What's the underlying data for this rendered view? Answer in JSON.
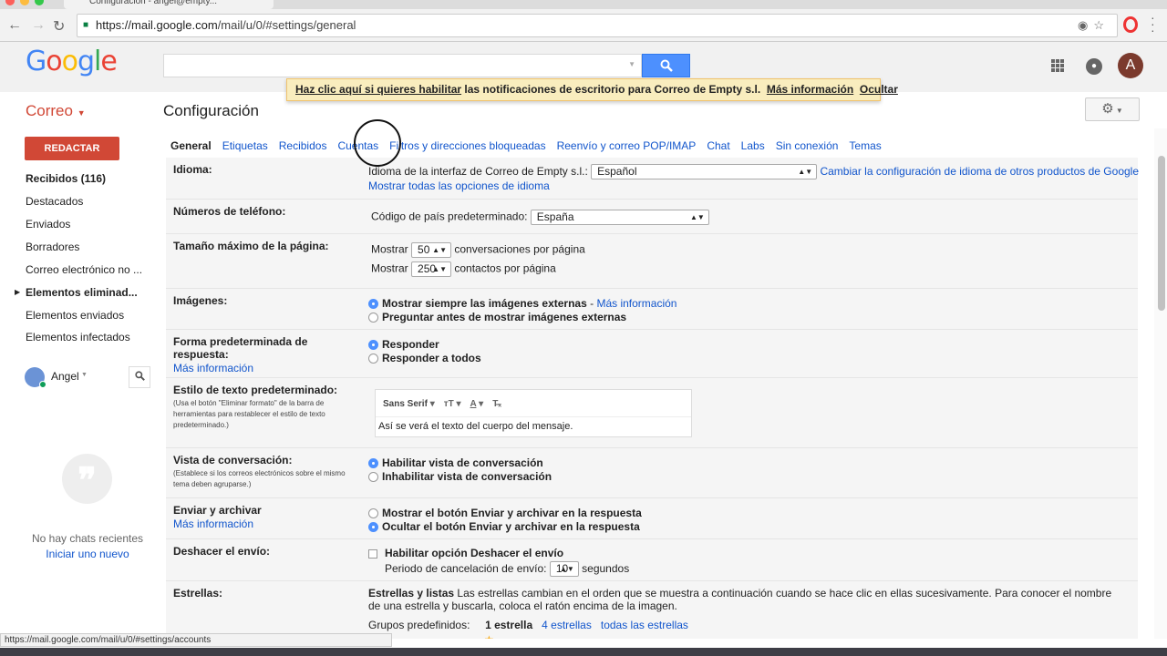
{
  "browser": {
    "tab_title": "Configuración - angel@empty...",
    "url_host": "https://mail.google.com",
    "url_path": "/mail/u/0/#settings/general",
    "status_url": "https://mail.google.com/mail/u/0/#settings/accounts"
  },
  "header": {
    "logo": "Google",
    "avatar_letter": "A"
  },
  "banner": {
    "enable_link": "Haz clic aquí si quieres habilitar",
    "text": " las notificaciones de escritorio para Correo de Empty s.l.",
    "more_info": "Más información",
    "dismiss": "Ocultar"
  },
  "subheader": {
    "app_menu": "Correo",
    "title": "Configuración"
  },
  "sidebar": {
    "compose": "REDACTAR",
    "folders": [
      "Recibidos (116)",
      "Destacados",
      "Enviados",
      "Borradores",
      "Correo electrónico no ...",
      "Elementos eliminad...",
      "Elementos enviados",
      "Elementos infectados"
    ],
    "chat_user": "Angel",
    "no_chats": "No hay chats recientes",
    "start_chat": "Iniciar uno nuevo"
  },
  "tabs": [
    "General",
    "Etiquetas",
    "Recibidos",
    "Cuentas",
    "Filtros y direcciones bloqueadas",
    "Reenvío y correo POP/IMAP",
    "Chat",
    "Labs",
    "Sin conexión",
    "Temas"
  ],
  "settings": {
    "language": {
      "label": "Idioma:",
      "prefix": "Idioma de la interfaz de Correo de Empty s.l.:",
      "value": "Español",
      "change_link": "Cambiar la configuración de idioma de otros productos de Google",
      "all_options": "Mostrar todas las opciones de idioma"
    },
    "phone": {
      "label": "Números de teléfono:",
      "prefix": "Código de país predeterminado:",
      "value": "España"
    },
    "pagesize": {
      "label": "Tamaño máximo de la página:",
      "show": "Mostrar",
      "conv_value": "50",
      "conv_suffix": "conversaciones por página",
      "contacts_value": "250",
      "contacts_suffix": "contactos por página"
    },
    "images": {
      "label": "Imágenes:",
      "opt1": "Mostrar siempre las imágenes externas",
      "opt1_link": "Más información",
      "opt2": "Preguntar antes de mostrar imágenes externas"
    },
    "reply": {
      "label": "Forma predeterminada de respuesta:",
      "link": "Más información",
      "opt1": "Responder",
      "opt2": "Responder a todos"
    },
    "textstyle": {
      "label": "Estilo de texto predeterminado:",
      "hint": "(Usa el botón \"Eliminar formato\" de la barra de herramientas para restablecer el estilo de texto predeterminado.)",
      "font": "Sans Serif",
      "sample": "Así se verá el texto del cuerpo del mensaje."
    },
    "conversation": {
      "label": "Vista de conversación:",
      "hint": "(Establece si los correos electrónicos sobre el mismo tema deben agruparse.)",
      "opt1": "Habilitar vista de conversación",
      "opt2": "Inhabilitar vista de conversación"
    },
    "sendarchive": {
      "label": "Enviar y archivar",
      "link": "Más información",
      "opt1": "Mostrar el botón Enviar y archivar en la respuesta",
      "opt2": "Ocultar el botón Enviar y archivar en la respuesta"
    },
    "undo": {
      "label": "Deshacer el envío:",
      "opt": "Habilitar opción Deshacer el envío",
      "period_prefix": "Periodo de cancelación de envío:",
      "period_value": "10",
      "period_suffix": "segundos"
    },
    "stars": {
      "label": "Estrellas:",
      "title": "Estrellas y listas",
      "desc": " Las estrellas cambian en el orden que se muestra a continuación cuando se hace clic en ellas sucesivamente. Para conocer el nombre de una estrella y buscarla, coloca el ratón encima de la imagen.",
      "groups": "Grupos predefinidos:",
      "one": "1 estrella",
      "four": "4 estrellas",
      "all": "todas las estrellas"
    }
  }
}
